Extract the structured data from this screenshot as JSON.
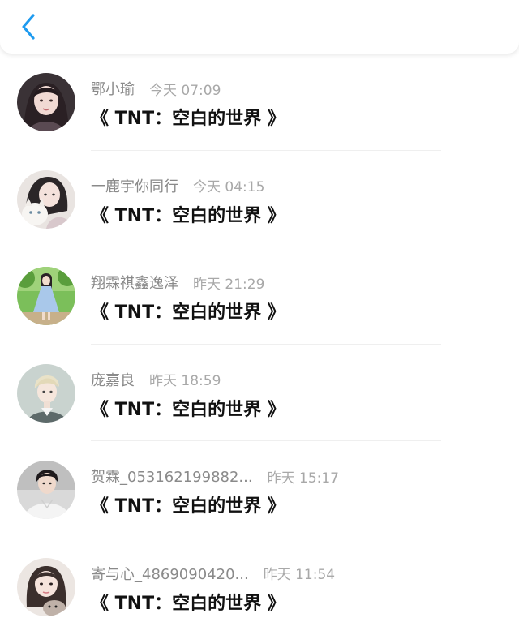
{
  "header": {
    "back_icon": "chevron-left-icon",
    "accent_color": "#1e9bf0"
  },
  "messages": [
    {
      "username": "鄂小瑜",
      "time": "今天 07:09",
      "text": "《 TNT：空白的世界 》",
      "avatar": "girl-portrait-dark-hair"
    },
    {
      "username": "一鹿宇你同行",
      "time": "今天 04:15",
      "text": "《 TNT：空白的世界 》",
      "avatar": "girl-holding-cat"
    },
    {
      "username": "翔霖祺鑫逸泽",
      "time": "昨天 21:29",
      "text": "《 TNT：空白的世界 》",
      "avatar": "girl-blue-dress-outdoors"
    },
    {
      "username": "庞嘉良",
      "time": "昨天 18:59",
      "text": "《 TNT：空白的世界 》",
      "avatar": "illustrated-boy"
    },
    {
      "username": "贺霖_053162199882...",
      "time": "昨天 15:17",
      "text": "《 TNT：空白的世界 》",
      "avatar": "boy-white-outfit"
    },
    {
      "username": "寄与心_4869090420...",
      "time": "昨天 11:54",
      "text": "《 TNT：空白的世界 》",
      "avatar": "girl-with-pet"
    }
  ]
}
